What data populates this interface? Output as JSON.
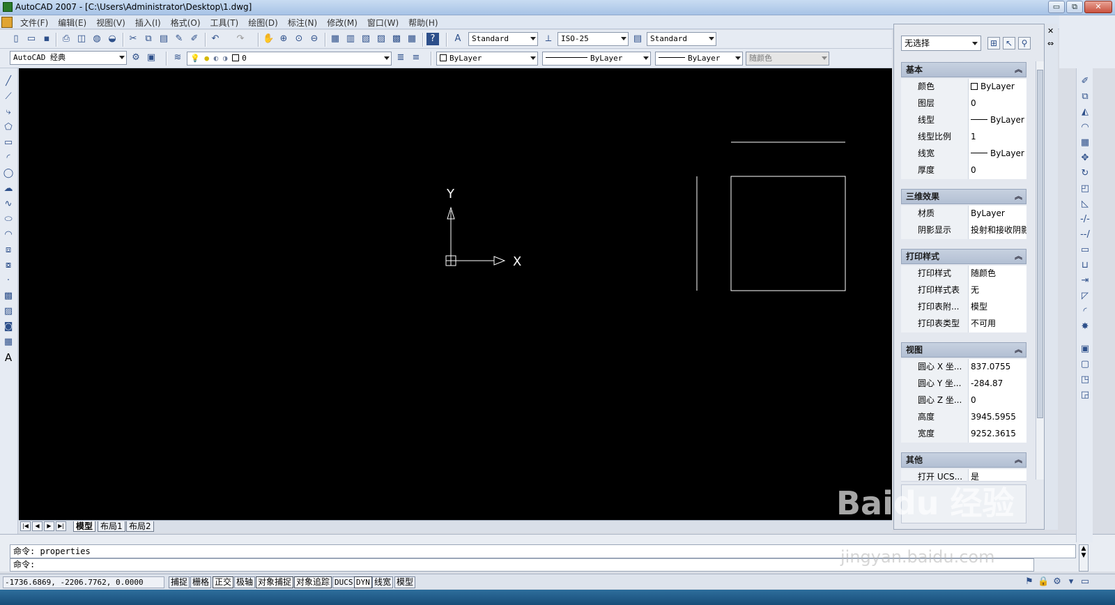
{
  "window": {
    "title": "AutoCAD 2007 - [C:\\Users\\Administrator\\Desktop\\1.dwg]",
    "controls": [
      "▭",
      "⧉",
      "✕"
    ]
  },
  "menu": [
    "文件(F)",
    "编辑(E)",
    "视图(V)",
    "插入(I)",
    "格式(O)",
    "工具(T)",
    "绘图(D)",
    "标注(N)",
    "修改(M)",
    "窗口(W)",
    "帮助(H)"
  ],
  "styles": {
    "text_style": "Standard",
    "dim_style": "ISO-25",
    "table_style": "Standard"
  },
  "workspace": "AutoCAD 经典",
  "layer": "0",
  "properties_bar": {
    "color": "ByLayer",
    "linetype": "ByLayer",
    "lineweight": "ByLayer",
    "plotstyle": "随颜色"
  },
  "ucs": {
    "x_label": "X",
    "y_label": "Y"
  },
  "tabs": [
    "模型",
    "布局1",
    "布局2"
  ],
  "command": {
    "history": "命令: properties",
    "prompt": "命令:"
  },
  "status": {
    "coords": "-1736.6869, -2206.7762, 0.0000",
    "buttons": [
      "捕捉",
      "栅格",
      "正交",
      "极轴",
      "对象捕捉",
      "对象追踪",
      "DUCS",
      "DYN",
      "线宽",
      "模型"
    ]
  },
  "palette": {
    "selection": "无选择",
    "sections": {
      "basic": "基本",
      "three_d": "三维效果",
      "plot": "打印样式",
      "view": "视图",
      "misc": "其他"
    },
    "rows": {
      "color": {
        "k": "颜色",
        "v": "ByLayer"
      },
      "layer": {
        "k": "图层",
        "v": "0"
      },
      "linetype": {
        "k": "线型",
        "v": "ByLayer"
      },
      "ltscale": {
        "k": "线型比例",
        "v": "1"
      },
      "lineweight": {
        "k": "线宽",
        "v": "ByLayer"
      },
      "thickness": {
        "k": "厚度",
        "v": "0"
      },
      "material": {
        "k": "材质",
        "v": "ByLayer"
      },
      "shadow": {
        "k": "阴影显示",
        "v": "投射和接收阴影"
      },
      "plotstyle": {
        "k": "打印样式",
        "v": "随颜色"
      },
      "plottable": {
        "k": "打印样式表",
        "v": "无"
      },
      "plotattach": {
        "k": "打印表附...",
        "v": "模型"
      },
      "plottype": {
        "k": "打印表类型",
        "v": "不可用"
      },
      "cx": {
        "k": "圆心 X 坐...",
        "v": "837.0755"
      },
      "cy": {
        "k": "圆心 Y 坐...",
        "v": "-284.87"
      },
      "cz": {
        "k": "圆心 Z 坐...",
        "v": "0"
      },
      "height": {
        "k": "高度",
        "v": "3945.5955"
      },
      "width": {
        "k": "宽度",
        "v": "9252.3615"
      },
      "ucs": {
        "k": "打开 UCS...",
        "v": "是"
      }
    }
  },
  "watermark": {
    "main": "Baidu 经验",
    "sub": "jingyan.baidu.com"
  }
}
